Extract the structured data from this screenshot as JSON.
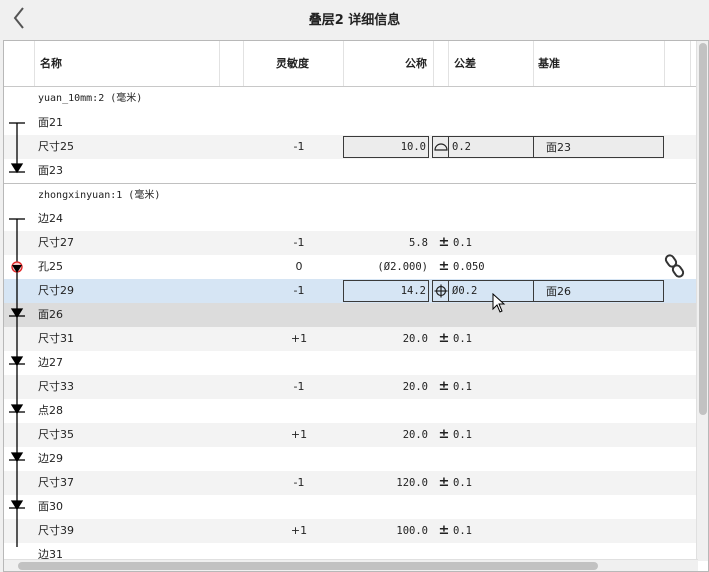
{
  "title": "叠层2 详细信息",
  "columns": {
    "name": "名称",
    "sensitivity": "灵敏度",
    "nominal": "公称",
    "tolerance": "公差",
    "datum": "基准"
  },
  "groups": [
    {
      "label": "yuan_10mm:2 (毫米)"
    },
    {
      "label": "zhongxinyuan:1 (毫米)"
    }
  ],
  "rows": [
    {
      "name": "面21"
    },
    {
      "name": "尺寸25",
      "sensitivity": "-1",
      "nominal": "10.0",
      "tolerance": "0.2",
      "datum": "面23",
      "symbol": "profile-of-surface-icon"
    },
    {
      "name": "面23"
    },
    {
      "name": "边24"
    },
    {
      "name": "尺寸27",
      "sensitivity": "-1",
      "nominal": "5.8",
      "pm": "±",
      "tolerance": "0.1"
    },
    {
      "name": "孔25",
      "sensitivity": "0",
      "nominal": "(Ø2.000)",
      "pm": "±",
      "tolerance": "0.050"
    },
    {
      "name": "尺寸29",
      "sensitivity": "-1",
      "nominal": "14.2",
      "tolerance": "Ø0.2",
      "datum": "面26",
      "symbol": "position-icon"
    },
    {
      "name": "面26"
    },
    {
      "name": "尺寸31",
      "sensitivity": "+1",
      "nominal": "20.0",
      "pm": "±",
      "tolerance": "0.1"
    },
    {
      "name": "边27"
    },
    {
      "name": "尺寸33",
      "sensitivity": "-1",
      "nominal": "20.0",
      "pm": "±",
      "tolerance": "0.1"
    },
    {
      "name": "点28"
    },
    {
      "name": "尺寸35",
      "sensitivity": "+1",
      "nominal": "20.0",
      "pm": "±",
      "tolerance": "0.1"
    },
    {
      "name": "边29"
    },
    {
      "name": "尺寸37",
      "sensitivity": "-1",
      "nominal": "120.0",
      "pm": "±",
      "tolerance": "0.1"
    },
    {
      "name": "面30"
    },
    {
      "name": "尺寸39",
      "sensitivity": "+1",
      "nominal": "100.0",
      "pm": "±",
      "tolerance": "0.1"
    },
    {
      "name": "边31"
    }
  ],
  "icons": {
    "back": "chevron-left-icon",
    "link": "chain-link-icon",
    "cursor": "mouse-pointer-icon"
  },
  "colors": {
    "selected_row": "#d6e5f4",
    "alt_row": "#f3f3f3",
    "highlight_row": "#dcdcdc",
    "hole_marker": "#e02020"
  }
}
